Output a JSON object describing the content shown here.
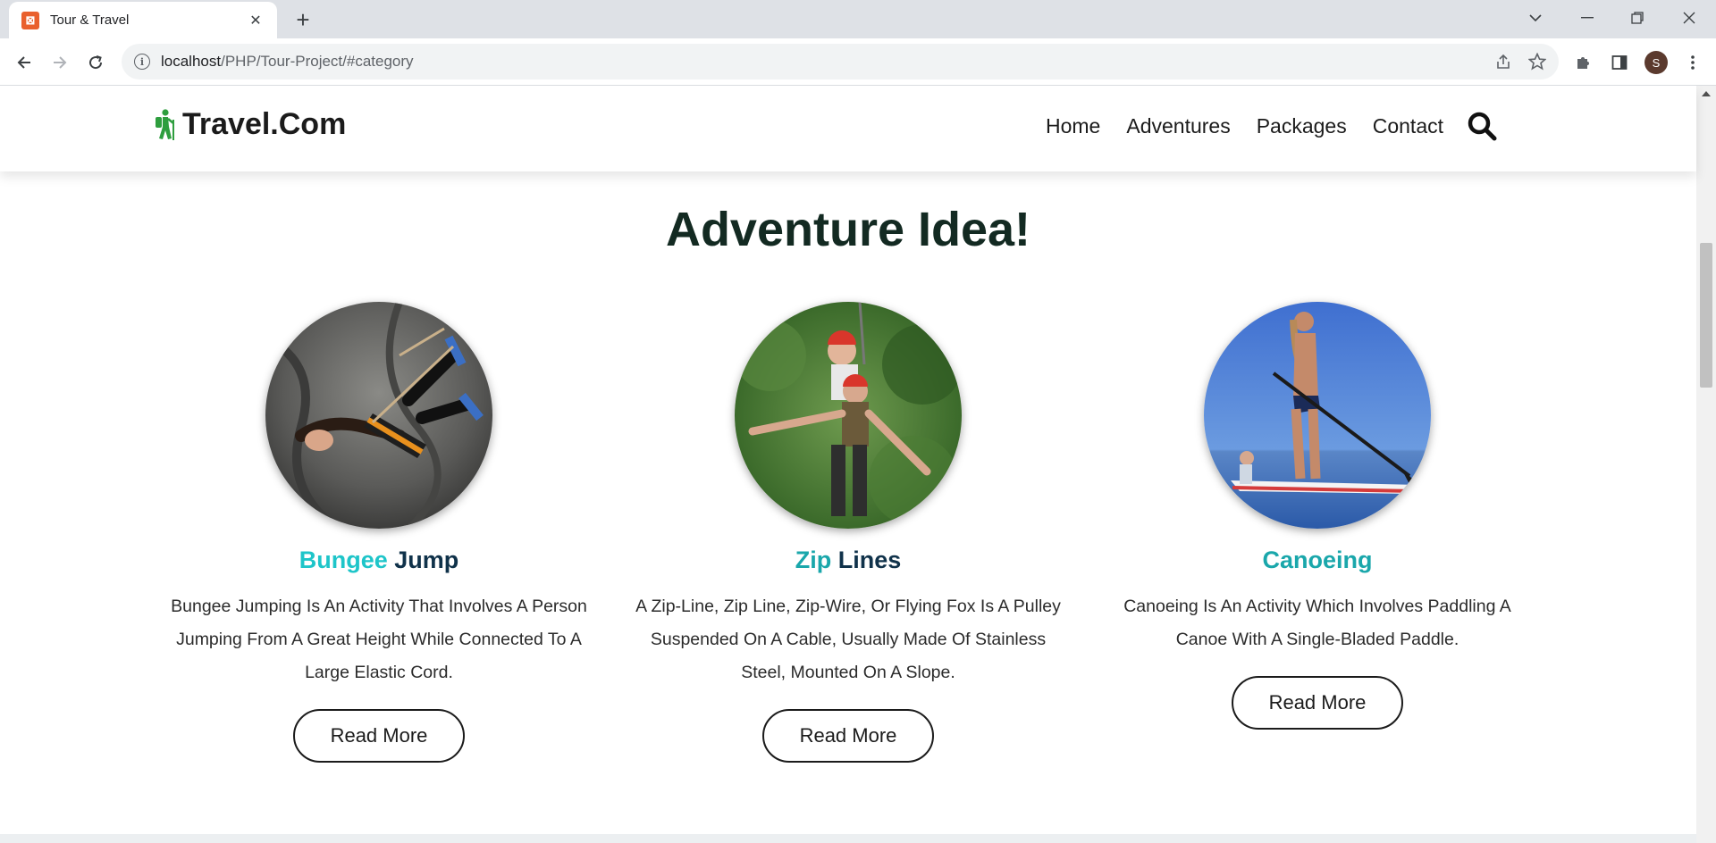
{
  "browser": {
    "tab_title": "Tour & Travel",
    "tab_close": "✕",
    "new_tab": "+",
    "url_host": "localhost",
    "url_path": "/PHP/Tour-Project/#category",
    "avatar_letter": "S"
  },
  "header": {
    "logo_text": "Travel.Com",
    "nav": [
      "Home",
      "Adventures",
      "Packages",
      "Contact"
    ]
  },
  "section": {
    "title": "Adventure Idea!"
  },
  "cards": [
    {
      "title_accent": "Bungee",
      "title_rest": " Jump",
      "text": "Bungee Jumping Is An Activity That Involves A Person Jumping From A Great Height While Connected To A Large Elastic Cord.",
      "button": "Read More",
      "image_icon": "bungee-jump-photo"
    },
    {
      "title_accent": "Zip",
      "title_rest": " Lines",
      "text": "A Zip-Line, Zip Line, Zip-Wire, Or Flying Fox Is A Pulley Suspended On A Cable, Usually Made Of Stainless Steel, Mounted On A Slope.",
      "button": "Read More",
      "image_icon": "zip-line-photo"
    },
    {
      "title_accent": "Canoeing",
      "title_rest": "",
      "text": "Canoeing Is An Activity Which Involves Paddling A Canoe With A Single-Bladed Paddle.",
      "button": "Read More",
      "image_icon": "canoeing-photo"
    }
  ],
  "colors": {
    "accent": "#1ec5c9",
    "title_dark": "#10324a",
    "heading": "#132a22",
    "logo_green": "#2e9e3e"
  }
}
